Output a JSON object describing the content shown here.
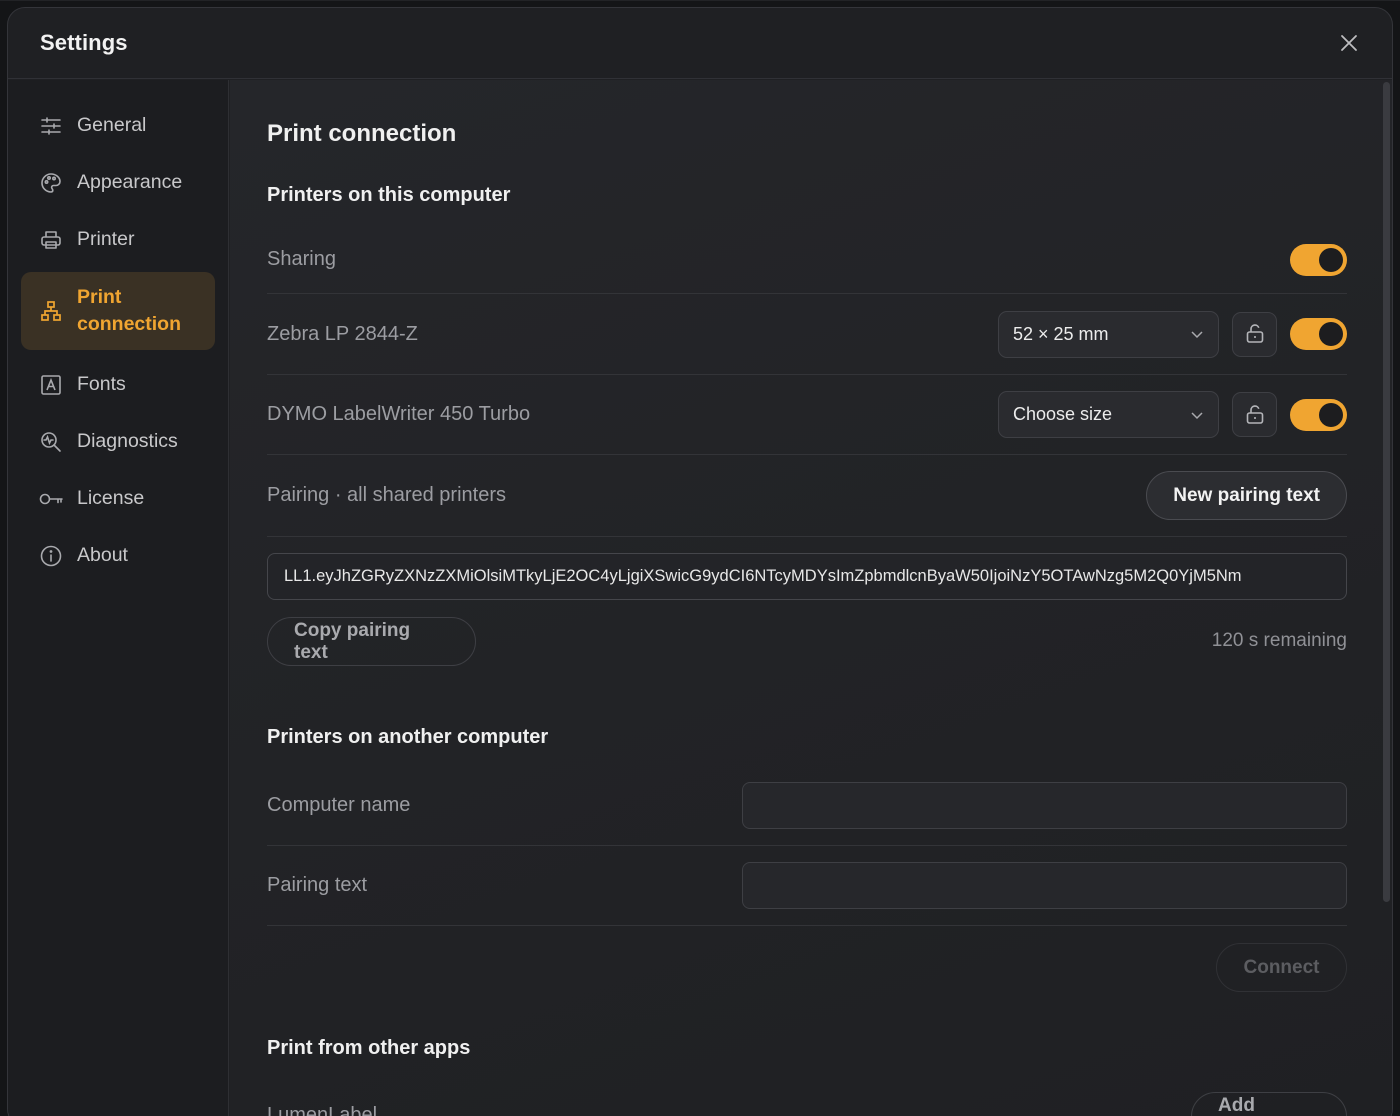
{
  "dialog": {
    "title": "Settings"
  },
  "sidebar": {
    "items": [
      {
        "label": "General",
        "icon": "sliders-icon"
      },
      {
        "label": "Appearance",
        "icon": "palette-icon"
      },
      {
        "label": "Printer",
        "icon": "printer-icon"
      },
      {
        "label": "Print connection",
        "icon": "network-icon",
        "active": true
      },
      {
        "label": "Fonts",
        "icon": "font-icon"
      },
      {
        "label": "Diagnostics",
        "icon": "diagnostics-icon"
      },
      {
        "label": "License",
        "icon": "key-icon"
      },
      {
        "label": "About",
        "icon": "info-icon"
      }
    ]
  },
  "main": {
    "title": "Print connection",
    "local": {
      "heading": "Printers on this computer",
      "sharing_label": "Sharing",
      "sharing_on": true,
      "printers": [
        {
          "name": "Zebra LP 2844-Z",
          "size": "52 × 25 mm",
          "shared": true
        },
        {
          "name": "DYMO LabelWriter 450 Turbo",
          "size": "Choose size",
          "shared": true
        }
      ],
      "pairing_label": "Pairing · all shared printers",
      "new_pairing_button": "New pairing text",
      "pairing_token": "LL1.eyJhZGRyZXNzZXMiOlsiMTkyLjE2OC4yLjgiXSwicG9ydCI6NTcyMDYsImZpbmdlcnByaW50IjoiNzY5OTAwNzg5M2Q0YjM5Nm",
      "copy_button": "Copy pairing text",
      "remaining": "120 s remaining"
    },
    "remote": {
      "heading": "Printers on another computer",
      "computer_name_label": "Computer name",
      "computer_name_value": "",
      "pairing_text_label": "Pairing text",
      "pairing_text_value": "",
      "connect_button": "Connect"
    },
    "apps": {
      "heading": "Print from other apps",
      "row_label": "LumenLabel",
      "add_button": "Add printer"
    }
  },
  "colors": {
    "accent": "#f0a531",
    "active_bg": "#3a3124",
    "dialog_bg": "#1f2023"
  }
}
